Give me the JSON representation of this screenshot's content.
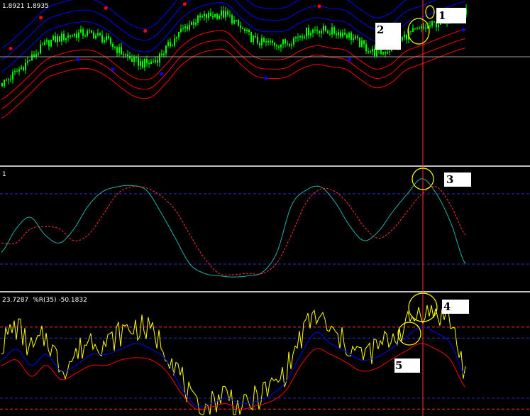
{
  "header": {
    "price_readout": "1.8921 1.8935",
    "osc_label": "1",
    "wpr_values": "23.7287",
    "wpr_name": "%R(35) -50.1832"
  },
  "annotations": [
    "1",
    "2",
    "3",
    "4",
    "5"
  ],
  "colors": {
    "background": "#000000",
    "candle": "#00ff00",
    "envelope_upper": "#0000ff",
    "envelope_lower": "#ff0000",
    "signal_dots_up": "#ff0000",
    "signal_dots_down": "#0000ff",
    "stoch_main": "#20b2aa",
    "stoch_signal": "#ff3030",
    "wpr_line": "#ffff00",
    "wpr_blue": "#0000ff",
    "wpr_red": "#ff0000",
    "vertical_marker": "#ff3030",
    "highlight_circle": "#ffff00"
  },
  "chart_data": [
    {
      "type": "line",
      "panel": "price",
      "series": [
        {
          "values": [
            62,
            72,
            84,
            96,
            101,
            104,
            104,
            98,
            88,
            80,
            80,
            92,
            107,
            116,
            120,
            120,
            108,
            98,
            96,
            97,
            104,
            108,
            106,
            104,
            95,
            88,
            92,
            103,
            108,
            113,
            118,
            122
          ]
        }
      ]
    },
    {
      "type": "line",
      "panel": "stochastic",
      "levels": [
        80,
        20
      ],
      "series": [
        {
          "values": [
            30,
            50,
            60,
            45,
            38,
            50,
            70,
            82,
            86,
            87,
            83,
            64,
            42,
            20,
            12,
            10,
            9,
            10,
            13,
            30,
            70,
            83,
            86,
            73,
            53,
            40,
            48,
            65,
            80,
            93,
            80,
            55,
            20
          ]
        },
        {
          "values": [
            38,
            38,
            50,
            52,
            50,
            40,
            45,
            62,
            80,
            86,
            85,
            78,
            66,
            45,
            25,
            12,
            11,
            12,
            12,
            21,
            45,
            72,
            84,
            82,
            70,
            52,
            42,
            50,
            65,
            80,
            86,
            70,
            45
          ]
        }
      ]
    },
    {
      "type": "line",
      "panel": "williams_r",
      "levels": [
        -20,
        -80
      ],
      "series": [
        {
          "values": [
            -35,
            -20,
            -40,
            -30,
            -55,
            -45,
            -30,
            -35,
            -25,
            -20,
            -25,
            -40,
            -65,
            -95,
            -90,
            -80,
            -95,
            -85,
            -75,
            -60,
            -30,
            -10,
            -25,
            -35,
            -45,
            -40,
            -30,
            -20,
            -5,
            -8,
            -15,
            -60
          ]
        },
        {
          "values": [
            -50,
            -40,
            -55,
            -45,
            -60,
            -55,
            -45,
            -45,
            -40,
            -35,
            -40,
            -50,
            -75,
            -92,
            -90,
            -85,
            -90,
            -88,
            -82,
            -70,
            -45,
            -25,
            -35,
            -42,
            -50,
            -48,
            -40,
            -30,
            -20,
            -25,
            -35,
            -65
          ]
        },
        {
          "values": [
            -55,
            -50,
            -65,
            -55,
            -68,
            -62,
            -55,
            -55,
            -50,
            -48,
            -50,
            -60,
            -80,
            -95,
            -93,
            -90,
            -95,
            -92,
            -88,
            -78,
            -55,
            -40,
            -45,
            -52,
            -60,
            -58,
            -50,
            -42,
            -35,
            -40,
            -50,
            -75
          ]
        }
      ]
    }
  ]
}
